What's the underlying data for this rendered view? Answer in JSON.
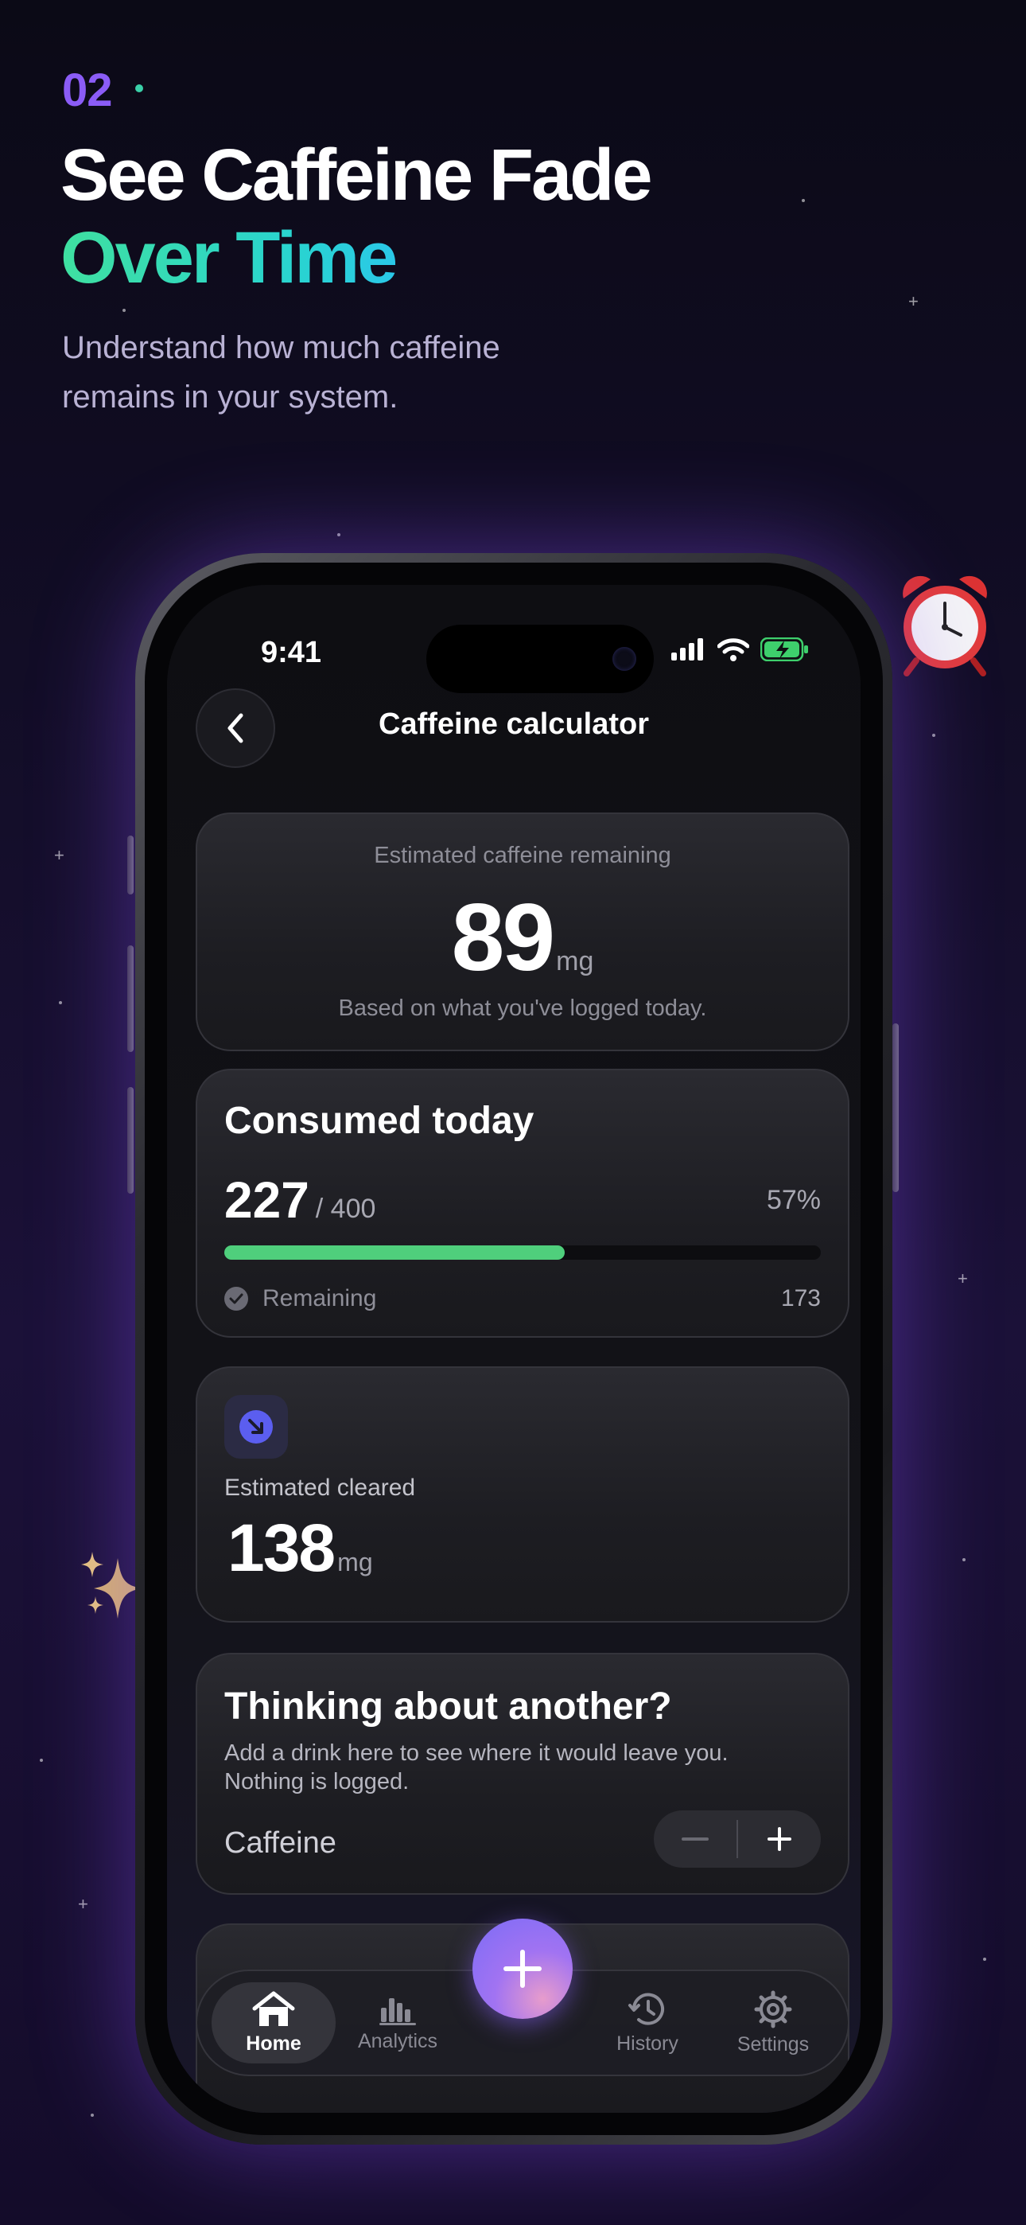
{
  "hero": {
    "step": "02",
    "title_line1": "See Caffeine Fade",
    "title_line2": "Over Time",
    "subtitle": "Understand how much caffeine remains in your system."
  },
  "status_bar": {
    "time": "9:41"
  },
  "nav": {
    "title": "Caffeine calculator"
  },
  "remaining_card": {
    "label": "Estimated caffeine remaining",
    "value": "89",
    "unit": "mg",
    "note": "Based on what you've logged today."
  },
  "consumed_card": {
    "title": "Consumed today",
    "value": "227",
    "limit": "/ 400",
    "percent_text": "57%",
    "progress_fraction": 0.57,
    "remaining_label": "Remaining",
    "remaining_value": "173"
  },
  "cleared_card": {
    "label": "Estimated cleared",
    "value": "138",
    "unit": "mg"
  },
  "whatif_card": {
    "title": "Thinking about another?",
    "description": "Add a drink here to see where it would leave you. Nothing is logged.",
    "field_label": "Caffeine"
  },
  "tabbar": {
    "home": "Home",
    "analytics": "Analytics",
    "history": "History",
    "settings": "Settings"
  },
  "colors": {
    "accent_purple": "#8b5cf6",
    "accent_teal": "#2ed4b0",
    "progress_green": "#4fcf7c"
  }
}
